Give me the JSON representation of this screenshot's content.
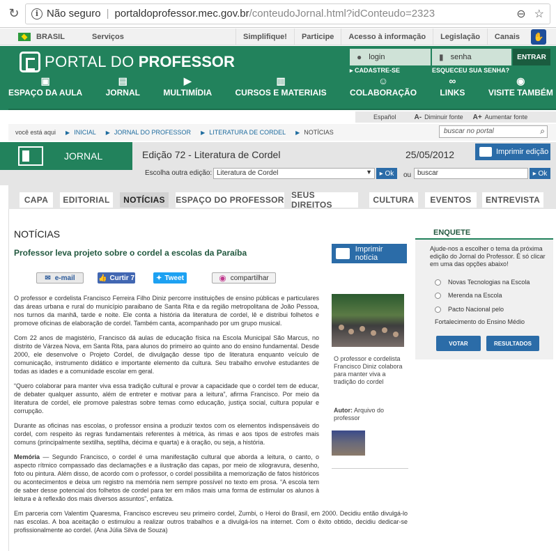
{
  "browser": {
    "security_label": "Não seguro",
    "url_host": "portaldoprofessor.mec.gov.br",
    "url_path": "/conteudoJornal.html?idConteudo=2323"
  },
  "govbar": {
    "brasil": "BRASIL",
    "servicos": "Serviços",
    "links": [
      "Simplifique!",
      "Participe",
      "Acesso à informação",
      "Legislação",
      "Canais"
    ]
  },
  "header": {
    "logo_text_1": "PORTAL DO",
    "logo_text_2": "PROFESSOR",
    "login_placeholder": "login",
    "senha_placeholder": "senha",
    "entrar": "ENTRAR",
    "cadastre": "▸ CADASTRE-SE",
    "esqueceu": "ESQUECEU SUA SENHA?"
  },
  "mainnav": [
    {
      "label": "ESPAÇO DA AULA",
      "icon": "school-icon",
      "glyph": "▣"
    },
    {
      "label": "JORNAL",
      "icon": "newspaper-icon",
      "glyph": "▤"
    },
    {
      "label": "MULTIMÍDIA",
      "icon": "play-icon",
      "glyph": "▶"
    },
    {
      "label": "CURSOS E MATERIAIS",
      "icon": "book-icon",
      "glyph": "▥"
    },
    {
      "label": "COLABORAÇÃO",
      "icon": "people-icon",
      "glyph": "☺"
    },
    {
      "label": "LINKS",
      "icon": "link-icon",
      "glyph": "∞"
    },
    {
      "label": "VISITE TAMBÉM",
      "icon": "eye-icon",
      "glyph": "◉"
    }
  ],
  "tools": {
    "espanol": "Español",
    "diminuir": "Diminuir fonte",
    "aumentar": "Aumentar fonte",
    "a_minus": "A-",
    "a_plus": "A+"
  },
  "breadcrumb": {
    "prefix": "você está aqui",
    "items": [
      "INICIAL",
      "JORNAL DO PROFESSOR",
      "LITERATURA DE CORDEL"
    ],
    "current": "NOTÍCIAS"
  },
  "search": {
    "placeholder": "buscar no portal"
  },
  "jornal": {
    "label": "JORNAL",
    "edition": "Edição 72 - Literatura de Cordel",
    "date": "25/05/2012",
    "print_edition": "Imprimir edição",
    "escolha_label": "Escolha outra edição:",
    "selected_edition": "Literatura de Cordel",
    "ok": "▸ Ok",
    "ou": "ou",
    "buscar": "buscar"
  },
  "tabs": [
    {
      "label": "CAPA",
      "active": false
    },
    {
      "label": "EDITORIAL",
      "active": false
    },
    {
      "label": "NOTÍCIAS",
      "active": true
    },
    {
      "label": "ESPAÇO DO PROFESSOR",
      "active": false
    },
    {
      "label": "SEUS DIREITOS",
      "active": false
    },
    {
      "label": "CULTURA",
      "active": false
    },
    {
      "label": "EVENTOS",
      "active": false
    },
    {
      "label": "ENTREVISTA",
      "active": false
    }
  ],
  "article": {
    "section": "NOTÍCIAS",
    "headline": "Professor leva projeto sobre o cordel a escolas da Paraíba",
    "print_news": "Imprimir notícia",
    "share": {
      "email": "e-mail",
      "curtir": "Curtir 7",
      "tweet": "Tweet",
      "compartilhar": "compartilhar"
    },
    "p1": "O professor e cordelista Francisco Ferreira Filho Diniz percorre instituições de ensino públicas e particulares das áreas urbana e rural do município paraibano de Santa Rita e da região metropolitana de João Pessoa, nos turnos da manhã, tarde e noite. Ele conta a história da literatura de cordel, lê e distribui folhetos e promove oficinas de elaboração de cordel. Também canta, acompanhado por um grupo musical.",
    "p2": "Com 22 anos de magistério, Francisco dá aulas de educação física na Escola Municipal São Marcus, no distrito de Várzea Nova, em Santa Rita, para alunos do primeiro ao quinto ano do ensino fundamental. Desde 2000, ele desenvolve o Projeto Cordel, de divulgação desse tipo de literatura enquanto veículo de comunicação, instrumento didático e importante elemento da cultura. Seu trabalho envolve estudantes de todas as idades e a comunidade escolar em geral.",
    "p3": "“Quero colaborar para manter viva essa tradição cultural e provar a capacidade que o cordel tem de educar, de debater qualquer assunto, além de entreter e motivar para a leitura”, afirma Francisco. Por meio da literatura de cordel, ele promove palestras sobre temas como educação, justiça social, cultura popular e corrupção.",
    "p4": "Durante as oficinas nas escolas, o professor ensina a produzir textos com os elementos indispensáveis do cordel, com respeito às regras fundamentais referentes à métrica, às rimas e aos tipos de estrofes mais comuns (principalmente sextilha, septilha, décima e quarta) e à oração, ou seja, a história.",
    "p5_bold": "Memória",
    "p5": " — Segundo Francisco, o cordel é uma manifestação cultural que aborda a leitura, o canto, o aspecto rítmico compassado das declamações e a ilustração das capas, por meio de xilogravura, desenho, foto ou pintura. Além disso, de acordo com o professor, o cordel possibilita a memorização de fatos históricos ou acontecimentos e deixa um registro na memória nem sempre possível no texto em prosa. “A escola tem de saber desse potencial dos folhetos de cordel para ter em mãos mais uma forma de estimular os alunos à leitura e à reflexão dos mais diversos assuntos”, enfatiza.",
    "p6": "Em parceria com Valentim Quaresma, Francisco escreveu seu primeiro cordel, Zumbi, o Heroi do Brasil, em 2000. Decidiu então divulgá-lo nas escolas. A boa aceitação o estimulou a realizar outros trabalhos e a divulgá-los na internet. Com o êxito obtido, decidiu dedicar-se profissionalmente ao cordel. (Ana Júlia Silva de Souza)",
    "caption": "O professor e cordelista Francisco Diniz colabora para manter viva a tradição do cordel",
    "autor_label": "Autor:",
    "autor": " Arquivo do professor"
  },
  "enquete": {
    "title": "ENQUETE",
    "question": "Ajude-nos a escolher o tema da próxima edição do Jornal do Professor. É só clicar em uma das opções abaixo!",
    "options": [
      "Novas Tecnologias na Escola",
      "Merenda na Escola",
      "Pacto Nacional pelo"
    ],
    "option3_cont": "Fortalecimento do Ensino Médio",
    "votar": "VOTAR",
    "resultados": "RESULTADOS"
  }
}
